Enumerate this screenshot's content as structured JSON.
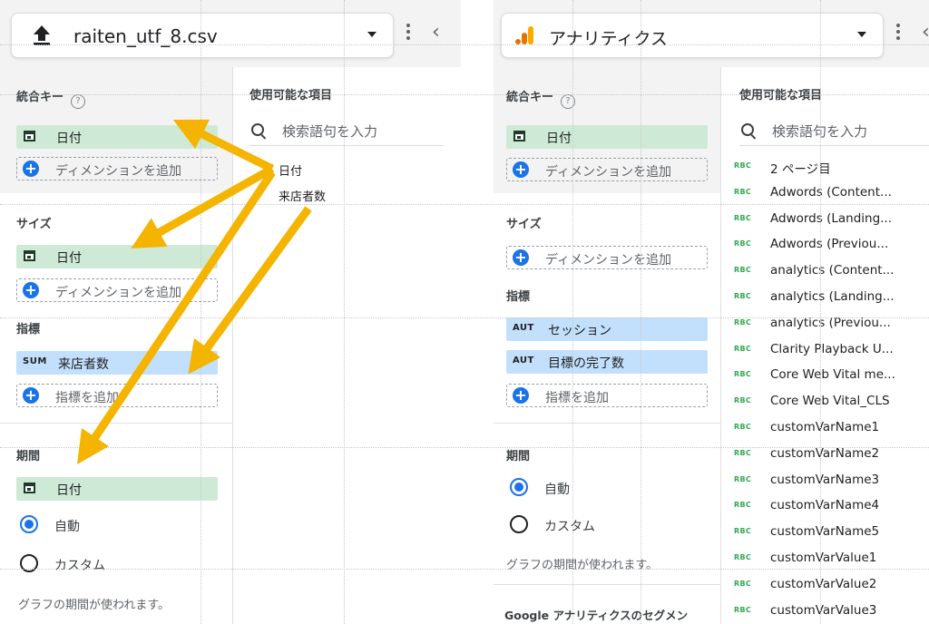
{
  "left_panel": {
    "title": "raiten_utf_8.csv",
    "icon": "upload-icon",
    "sections": {
      "join_key": "統合キー",
      "size": "サイズ",
      "metrics": "指標",
      "period": "期間"
    },
    "help_glyph": "?",
    "join_key_chip": "日付",
    "add_dimension": "ディメンションを追加",
    "size_chip": "日付",
    "add_dimension_2": "ディメンションを追加",
    "metric_chip": {
      "agg": "SUM",
      "label": "来店者数"
    },
    "add_metric": "指標を追加",
    "period_chip": "日付",
    "radio_auto": "自動",
    "radio_custom": "カスタム",
    "note": "グラフの期間が使われます。",
    "available_heading": "使用可能な項目",
    "search_placeholder": "検索語句を入力",
    "fields": [
      "日付",
      "来店者数"
    ]
  },
  "right_panel": {
    "title": "アナリティクス",
    "icon": "analytics-icon",
    "sections": {
      "join_key": "統合キー",
      "size": "サイズ",
      "metrics": "指標",
      "period": "期間",
      "segment": "Google アナリティクスのセグメン"
    },
    "help_glyph": "?",
    "join_key_chip": "日付",
    "add_dimension": "ディメンションを追加",
    "add_dimension_2": "ディメンションを追加",
    "metric_chips": [
      {
        "agg": "AUT",
        "label": "セッション"
      },
      {
        "agg": "AUT",
        "label": "目標の完了数"
      }
    ],
    "add_metric": "指標を追加",
    "radio_auto": "自動",
    "radio_custom": "カスタム",
    "note": "グラフの期間が使われます。",
    "available_heading": "使用可能な項目",
    "search_placeholder": "検索語句を入力",
    "field_type": "RBC",
    "fields": [
      "2 ページ目",
      "Adwords (Content...",
      "Adwords (Landing...",
      "Adwords (Previou...",
      "analytics (Content...",
      "analytics (Landing...",
      "analytics (Previou...",
      "Clarity Playback U...",
      "Core Web Vital me...",
      "Core Web Vital_CLS",
      "customVarName1",
      "customVarName2",
      "customVarName3",
      "customVarName4",
      "customVarName5",
      "customVarValue1",
      "customVarValue2",
      "customVarValue3"
    ]
  },
  "colors": {
    "dimension_chip": "#ceead6",
    "metric_chip": "#c2e0fb",
    "accent_blue": "#1a73e8",
    "arrow": "#f4b400",
    "analytics_orange": "#f9ab00",
    "analytics_dark": "#e37400"
  }
}
